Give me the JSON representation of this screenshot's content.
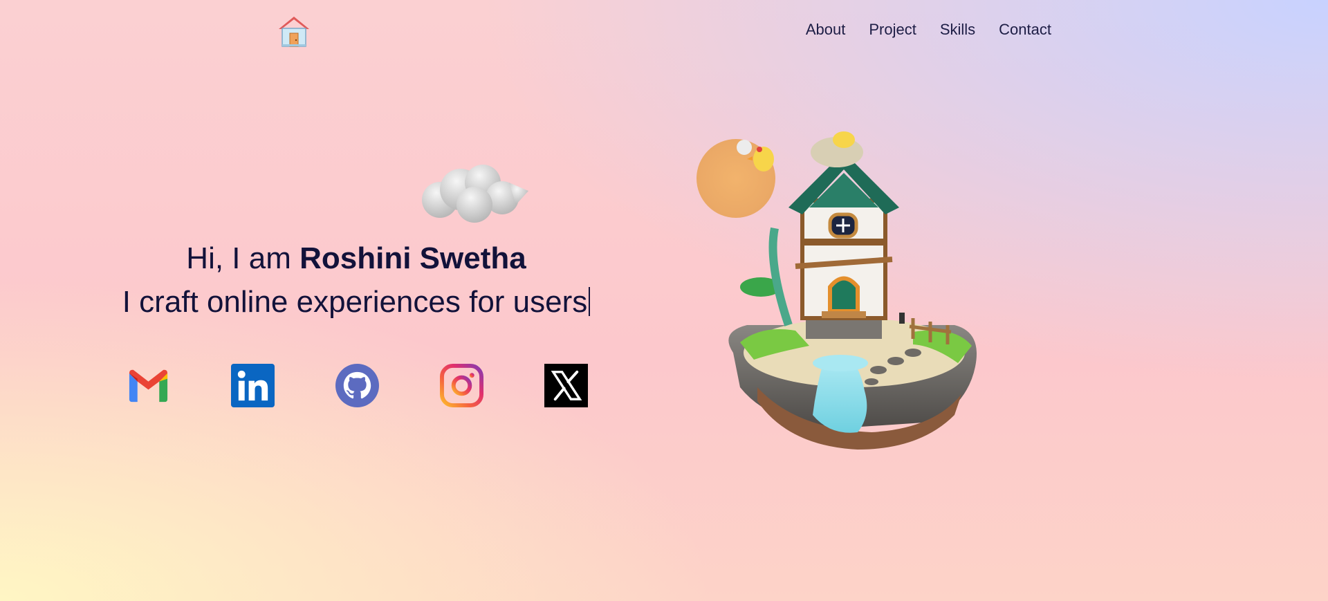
{
  "header": {
    "logo_icon": "house-icon",
    "nav": [
      {
        "label": "About"
      },
      {
        "label": "Project"
      },
      {
        "label": "Skills"
      },
      {
        "label": "Contact"
      }
    ]
  },
  "hero": {
    "greeting_prefix": "Hi, I am ",
    "name": "Roshini Swetha",
    "tagline": "I craft online experiences for users"
  },
  "socials": [
    {
      "icon": "gmail-icon"
    },
    {
      "icon": "linkedin-icon"
    },
    {
      "icon": "github-icon"
    },
    {
      "icon": "instagram-icon"
    },
    {
      "icon": "x-icon"
    }
  ],
  "colors": {
    "text": "#12123a",
    "linkedin": "#0a66c2",
    "github": "#5c6bc0",
    "x": "#000000"
  }
}
